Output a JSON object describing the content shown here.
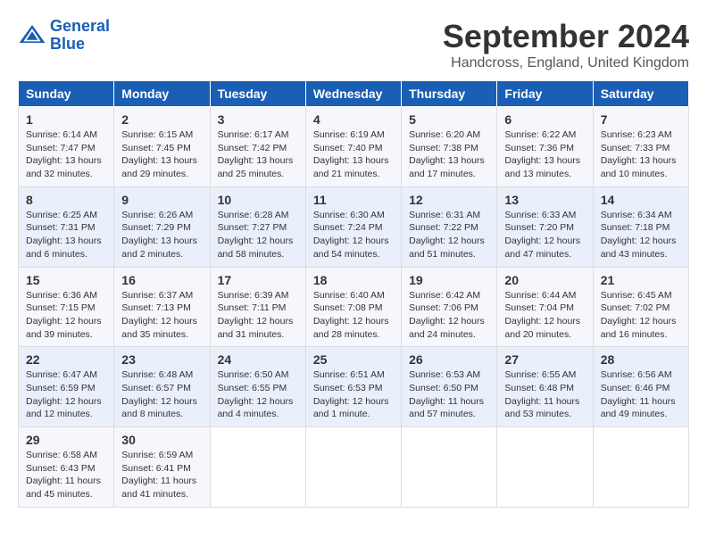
{
  "logo": {
    "line1": "General",
    "line2": "Blue"
  },
  "title": "September 2024",
  "location": "Handcross, England, United Kingdom",
  "days_header": [
    "Sunday",
    "Monday",
    "Tuesday",
    "Wednesday",
    "Thursday",
    "Friday",
    "Saturday"
  ],
  "weeks": [
    [
      {
        "day": "1",
        "sunrise": "6:14 AM",
        "sunset": "7:47 PM",
        "daylight": "13 hours and 32 minutes."
      },
      {
        "day": "2",
        "sunrise": "6:15 AM",
        "sunset": "7:45 PM",
        "daylight": "13 hours and 29 minutes."
      },
      {
        "day": "3",
        "sunrise": "6:17 AM",
        "sunset": "7:42 PM",
        "daylight": "13 hours and 25 minutes."
      },
      {
        "day": "4",
        "sunrise": "6:19 AM",
        "sunset": "7:40 PM",
        "daylight": "13 hours and 21 minutes."
      },
      {
        "day": "5",
        "sunrise": "6:20 AM",
        "sunset": "7:38 PM",
        "daylight": "13 hours and 17 minutes."
      },
      {
        "day": "6",
        "sunrise": "6:22 AM",
        "sunset": "7:36 PM",
        "daylight": "13 hours and 13 minutes."
      },
      {
        "day": "7",
        "sunrise": "6:23 AM",
        "sunset": "7:33 PM",
        "daylight": "13 hours and 10 minutes."
      }
    ],
    [
      {
        "day": "8",
        "sunrise": "6:25 AM",
        "sunset": "7:31 PM",
        "daylight": "13 hours and 6 minutes."
      },
      {
        "day": "9",
        "sunrise": "6:26 AM",
        "sunset": "7:29 PM",
        "daylight": "13 hours and 2 minutes."
      },
      {
        "day": "10",
        "sunrise": "6:28 AM",
        "sunset": "7:27 PM",
        "daylight": "12 hours and 58 minutes."
      },
      {
        "day": "11",
        "sunrise": "6:30 AM",
        "sunset": "7:24 PM",
        "daylight": "12 hours and 54 minutes."
      },
      {
        "day": "12",
        "sunrise": "6:31 AM",
        "sunset": "7:22 PM",
        "daylight": "12 hours and 51 minutes."
      },
      {
        "day": "13",
        "sunrise": "6:33 AM",
        "sunset": "7:20 PM",
        "daylight": "12 hours and 47 minutes."
      },
      {
        "day": "14",
        "sunrise": "6:34 AM",
        "sunset": "7:18 PM",
        "daylight": "12 hours and 43 minutes."
      }
    ],
    [
      {
        "day": "15",
        "sunrise": "6:36 AM",
        "sunset": "7:15 PM",
        "daylight": "12 hours and 39 minutes."
      },
      {
        "day": "16",
        "sunrise": "6:37 AM",
        "sunset": "7:13 PM",
        "daylight": "12 hours and 35 minutes."
      },
      {
        "day": "17",
        "sunrise": "6:39 AM",
        "sunset": "7:11 PM",
        "daylight": "12 hours and 31 minutes."
      },
      {
        "day": "18",
        "sunrise": "6:40 AM",
        "sunset": "7:08 PM",
        "daylight": "12 hours and 28 minutes."
      },
      {
        "day": "19",
        "sunrise": "6:42 AM",
        "sunset": "7:06 PM",
        "daylight": "12 hours and 24 minutes."
      },
      {
        "day": "20",
        "sunrise": "6:44 AM",
        "sunset": "7:04 PM",
        "daylight": "12 hours and 20 minutes."
      },
      {
        "day": "21",
        "sunrise": "6:45 AM",
        "sunset": "7:02 PM",
        "daylight": "12 hours and 16 minutes."
      }
    ],
    [
      {
        "day": "22",
        "sunrise": "6:47 AM",
        "sunset": "6:59 PM",
        "daylight": "12 hours and 12 minutes."
      },
      {
        "day": "23",
        "sunrise": "6:48 AM",
        "sunset": "6:57 PM",
        "daylight": "12 hours and 8 minutes."
      },
      {
        "day": "24",
        "sunrise": "6:50 AM",
        "sunset": "6:55 PM",
        "daylight": "12 hours and 4 minutes."
      },
      {
        "day": "25",
        "sunrise": "6:51 AM",
        "sunset": "6:53 PM",
        "daylight": "12 hours and 1 minute."
      },
      {
        "day": "26",
        "sunrise": "6:53 AM",
        "sunset": "6:50 PM",
        "daylight": "11 hours and 57 minutes."
      },
      {
        "day": "27",
        "sunrise": "6:55 AM",
        "sunset": "6:48 PM",
        "daylight": "11 hours and 53 minutes."
      },
      {
        "day": "28",
        "sunrise": "6:56 AM",
        "sunset": "6:46 PM",
        "daylight": "11 hours and 49 minutes."
      }
    ],
    [
      {
        "day": "29",
        "sunrise": "6:58 AM",
        "sunset": "6:43 PM",
        "daylight": "11 hours and 45 minutes."
      },
      {
        "day": "30",
        "sunrise": "6:59 AM",
        "sunset": "6:41 PM",
        "daylight": "11 hours and 41 minutes."
      },
      null,
      null,
      null,
      null,
      null
    ]
  ]
}
